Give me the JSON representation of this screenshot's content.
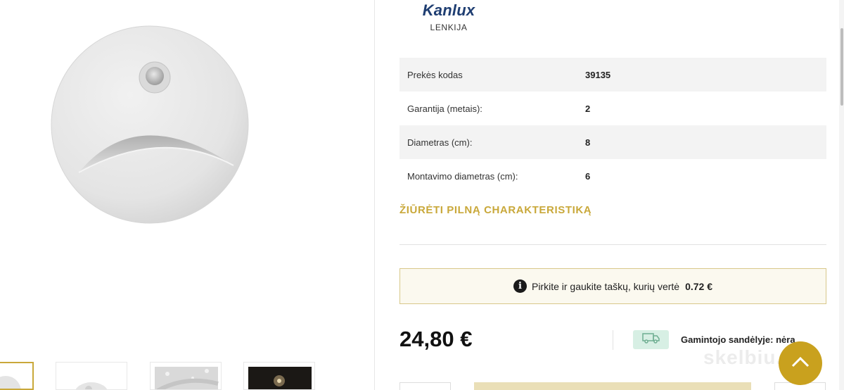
{
  "brand": {
    "name": "Kanlux",
    "country": "LENKIJA"
  },
  "specs": [
    {
      "label": "Prekės kodas",
      "value": "39135"
    },
    {
      "label": "Garantija (metais):",
      "value": "2"
    },
    {
      "label": "Diametras (cm):",
      "value": "8"
    },
    {
      "label": "Montavimo diametras (cm):",
      "value": "6"
    }
  ],
  "full_spec_link": "ŽIŪRĖTI PILNĄ CHARAKTERISTIKĄ",
  "points": {
    "text": "Pirkite ir gaukite taškų, kurių vertė",
    "value": "0.72 €"
  },
  "price": "24,80 €",
  "stock": {
    "text": "Gamintojo sandėlyje: nėra"
  },
  "watermark": "skelbiu.lt",
  "colors": {
    "accent": "#c9a83a",
    "brand": "#1f3e72",
    "stock_badge": "#d7efe4"
  },
  "icons": {
    "info": "info-icon",
    "truck": "truck-icon",
    "scroll_top": "chevron-up-icon"
  }
}
